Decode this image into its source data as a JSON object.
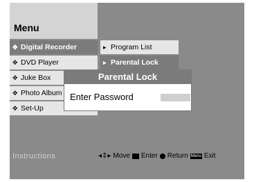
{
  "menu": {
    "title": "Menu"
  },
  "sidebar": {
    "items": [
      {
        "label": "Digital Recorder",
        "selected": true
      },
      {
        "label": "DVD Player",
        "selected": false
      },
      {
        "label": "Juke Box",
        "selected": false
      },
      {
        "label": "Photo Album",
        "selected": false
      },
      {
        "label": "Set-Up",
        "selected": false
      }
    ]
  },
  "submenu": {
    "items": [
      {
        "label": "Program List",
        "selected": false
      },
      {
        "label": "Parental Lock",
        "selected": true
      }
    ]
  },
  "dialog": {
    "title": "Parental Lock",
    "label": "Enter Password",
    "password_value": ""
  },
  "footer": {
    "instructions": "Instructions",
    "move_symbol": "◂⇕▸",
    "move": "Move",
    "enter": "Enter",
    "return": "Return",
    "menu_key": "Menu",
    "exit": "Exit"
  },
  "colors": {
    "panel": "#8a8a8a",
    "light": "#e6e6e6",
    "selected": "#7b7b7b"
  },
  "icons": {
    "bullet": "diamond-arrows-icon",
    "sub": "play-arrow-icon"
  }
}
